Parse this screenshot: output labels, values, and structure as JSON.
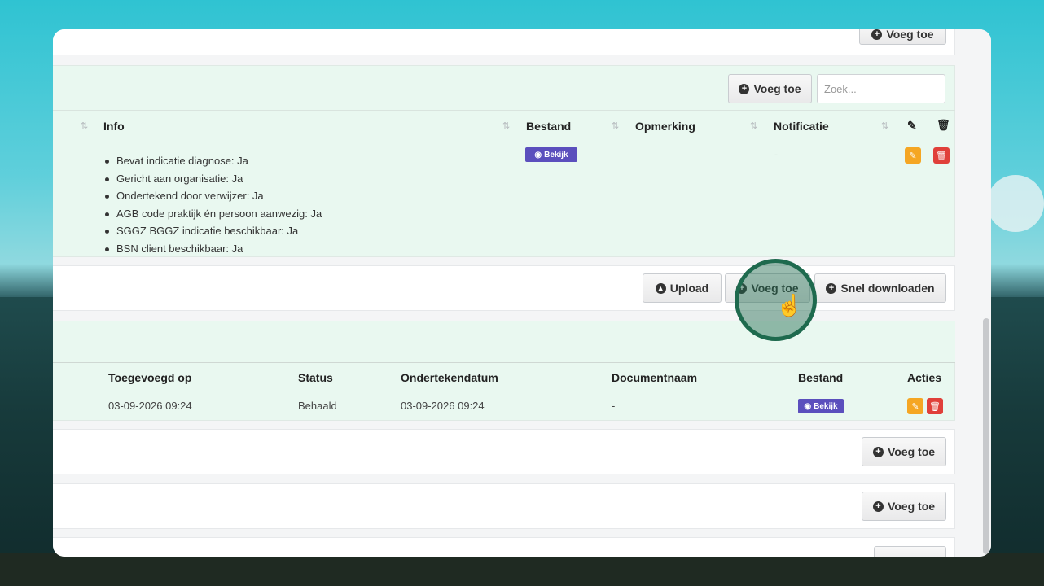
{
  "top": {
    "add_label": "Voeg toe"
  },
  "section1": {
    "add_label": "Voeg toe",
    "search_placeholder": "Zoek...",
    "headers": {
      "info": "Info",
      "bestand": "Bestand",
      "opmerking": "Opmerking",
      "notificatie": "Notificatie"
    },
    "info_items": [
      "Bevat indicatie diagnose: Ja",
      "Gericht aan organisatie: Ja",
      "Ondertekend door verwijzer: Ja",
      "AGB code praktijk én persoon aanwezig: Ja",
      "SGGZ BGGZ indicatie beschikbaar: Ja",
      "BSN client beschikbaar: Ja"
    ],
    "view_label": "Bekijk",
    "notificatie_value": "-"
  },
  "section2": {
    "upload_label": "Upload",
    "add_label": "Voeg toe",
    "download_label": "Snel downloaden"
  },
  "section3": {
    "headers": {
      "toegevoegd": "Toegevoegd op",
      "status": "Status",
      "ondertekendatum": "Ondertekendatum",
      "documentnaam": "Documentnaam",
      "bestand": "Bestand",
      "acties": "Acties"
    },
    "row": {
      "toegevoegd": "03-09-2026 09:24",
      "status": "Behaald",
      "ondertekendatum": "03-09-2026 09:24",
      "documentnaam": "-",
      "view_label": "Bekijk"
    }
  },
  "section4": {
    "add_label": "Voeg toe"
  },
  "section5": {
    "add_label": "Voeg toe"
  },
  "colors": {
    "accent_green": "#1e6a4e",
    "badge_purple": "#5b4fbd",
    "edit_orange": "#f5a623",
    "delete_red": "#e0403a",
    "row_green": "#e9f8f0"
  }
}
